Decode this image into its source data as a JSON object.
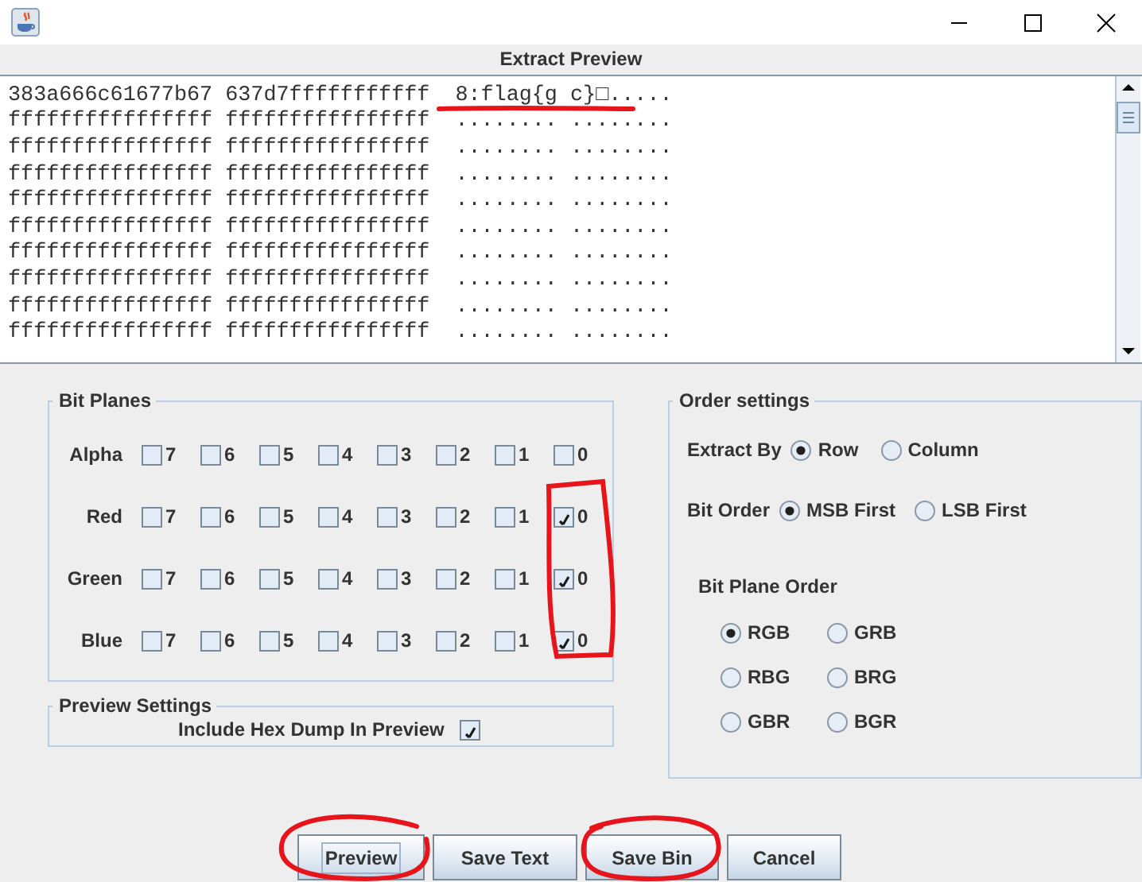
{
  "window": {
    "title": "Extract Preview"
  },
  "preview": {
    "rows": [
      {
        "hex": "383a666c61677b67 637d7fffffffffff",
        "ascii": "8:flag{g c}□....."
      },
      {
        "hex": "ffffffffffffffff ffffffffffffffff",
        "ascii": "........ ........"
      },
      {
        "hex": "ffffffffffffffff ffffffffffffffff",
        "ascii": "........ ........"
      },
      {
        "hex": "ffffffffffffffff ffffffffffffffff",
        "ascii": "........ ........"
      },
      {
        "hex": "ffffffffffffffff ffffffffffffffff",
        "ascii": "........ ........"
      },
      {
        "hex": "ffffffffffffffff ffffffffffffffff",
        "ascii": "........ ........"
      },
      {
        "hex": "ffffffffffffffff ffffffffffffffff",
        "ascii": "........ ........"
      },
      {
        "hex": "ffffffffffffffff ffffffffffffffff",
        "ascii": "........ ........"
      },
      {
        "hex": "ffffffffffffffff ffffffffffffffff",
        "ascii": "........ ........"
      },
      {
        "hex": "ffffffffffffffff ffffffffffffffff",
        "ascii": "........ ........"
      }
    ]
  },
  "bit_planes": {
    "title": "Bit Planes",
    "channels": [
      {
        "name": "Alpha",
        "bits": [
          {
            "label": "7",
            "checked": false
          },
          {
            "label": "6",
            "checked": false
          },
          {
            "label": "5",
            "checked": false
          },
          {
            "label": "4",
            "checked": false
          },
          {
            "label": "3",
            "checked": false
          },
          {
            "label": "2",
            "checked": false
          },
          {
            "label": "1",
            "checked": false
          },
          {
            "label": "0",
            "checked": false
          }
        ]
      },
      {
        "name": "Red",
        "bits": [
          {
            "label": "7",
            "checked": false
          },
          {
            "label": "6",
            "checked": false
          },
          {
            "label": "5",
            "checked": false
          },
          {
            "label": "4",
            "checked": false
          },
          {
            "label": "3",
            "checked": false
          },
          {
            "label": "2",
            "checked": false
          },
          {
            "label": "1",
            "checked": false
          },
          {
            "label": "0",
            "checked": true
          }
        ]
      },
      {
        "name": "Green",
        "bits": [
          {
            "label": "7",
            "checked": false
          },
          {
            "label": "6",
            "checked": false
          },
          {
            "label": "5",
            "checked": false
          },
          {
            "label": "4",
            "checked": false
          },
          {
            "label": "3",
            "checked": false
          },
          {
            "label": "2",
            "checked": false
          },
          {
            "label": "1",
            "checked": false
          },
          {
            "label": "0",
            "checked": true
          }
        ]
      },
      {
        "name": "Blue",
        "bits": [
          {
            "label": "7",
            "checked": false
          },
          {
            "label": "6",
            "checked": false
          },
          {
            "label": "5",
            "checked": false
          },
          {
            "label": "4",
            "checked": false
          },
          {
            "label": "3",
            "checked": false
          },
          {
            "label": "2",
            "checked": false
          },
          {
            "label": "1",
            "checked": false
          },
          {
            "label": "0",
            "checked": true
          }
        ]
      }
    ]
  },
  "preview_settings": {
    "title": "Preview Settings",
    "label": "Include Hex Dump In Preview",
    "checked": true
  },
  "order_settings": {
    "title": "Order settings",
    "extract_by": {
      "label": "Extract By",
      "options": [
        {
          "label": "Row",
          "selected": true
        },
        {
          "label": "Column",
          "selected": false
        }
      ]
    },
    "bit_order": {
      "label": "Bit Order",
      "options": [
        {
          "label": "MSB First",
          "selected": true
        },
        {
          "label": "LSB First",
          "selected": false
        }
      ]
    },
    "bit_plane_order": {
      "label": "Bit Plane Order",
      "options": [
        {
          "label": "RGB",
          "selected": true
        },
        {
          "label": "GRB",
          "selected": false
        },
        {
          "label": "RBG",
          "selected": false
        },
        {
          "label": "BRG",
          "selected": false
        },
        {
          "label": "GBR",
          "selected": false
        },
        {
          "label": "BGR",
          "selected": false
        }
      ]
    }
  },
  "buttons": [
    {
      "label": "Preview",
      "focused": true
    },
    {
      "label": "Save Text",
      "focused": false
    },
    {
      "label": "Save Bin",
      "focused": false
    },
    {
      "label": "Cancel",
      "focused": false
    }
  ],
  "ink_marks": true
}
